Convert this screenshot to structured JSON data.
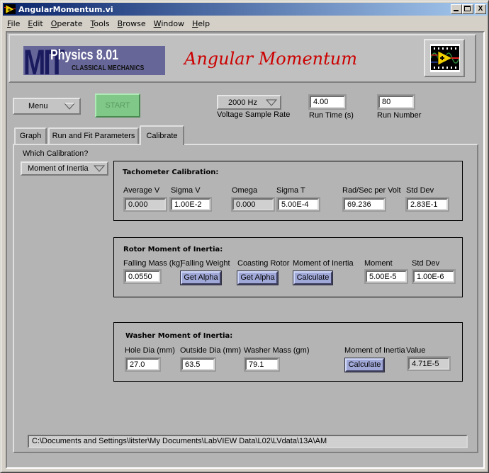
{
  "window": {
    "title": "AngularMomentum.vi",
    "buttons": {
      "minimize": "_",
      "maximize": "□",
      "close": "X"
    }
  },
  "menubar": {
    "items": [
      {
        "label": "File",
        "accel": "F"
      },
      {
        "label": "Edit",
        "accel": "E"
      },
      {
        "label": "Operate",
        "accel": "O"
      },
      {
        "label": "Tools",
        "accel": "T"
      },
      {
        "label": "Browse",
        "accel": "B"
      },
      {
        "label": "Window",
        "accel": "W"
      },
      {
        "label": "Help",
        "accel": "H"
      }
    ]
  },
  "header": {
    "logo": {
      "mit": "MIT",
      "course": "Physics 8.01",
      "subtitle": "CLASSICAL MECHANICS"
    },
    "title": "Angular Momentum",
    "vi_icon": "labview-vi-icon",
    "colors": {
      "title": "#cc0000",
      "logo_bg": "#666699",
      "start_button": "#80c888"
    }
  },
  "controls": {
    "menu_ring": "Menu",
    "start_button": "START",
    "sample_rate": {
      "value": "2000 Hz",
      "label": "Voltage Sample Rate"
    },
    "run_time": {
      "value": "4.00",
      "label": "Run Time (s)"
    },
    "run_number": {
      "value": "80",
      "label": "Run Number"
    }
  },
  "tabs": [
    {
      "label": "Graph",
      "active": false
    },
    {
      "label": "Run and Fit Parameters",
      "active": false
    },
    {
      "label": "Calibrate",
      "active": true
    }
  ],
  "calibrate": {
    "which_label": "Which Calibration?",
    "which_value": "Moment of Inertia",
    "tachometer": {
      "title": "Tachometer Calibration:",
      "average_v": {
        "label": "Average V",
        "value": "0.000"
      },
      "sigma_v": {
        "label": "Sigma V",
        "value": "1.00E-2"
      },
      "omega": {
        "label": "Omega",
        "value": "0.000"
      },
      "sigma_t": {
        "label": "Sigma T",
        "value": "5.00E-4"
      },
      "rad_per_volt": {
        "label": "Rad/Sec per Volt",
        "value": "69.236"
      },
      "std_dev": {
        "label": "Std Dev",
        "value": "2.83E-1"
      }
    },
    "rotor": {
      "title": "Rotor Moment of Inertia:",
      "falling_mass": {
        "label": "Falling Mass (kg)",
        "value": "0.0550"
      },
      "falling_weight": {
        "label": "Falling Weight",
        "button": "Get Alpha"
      },
      "coasting_rotor": {
        "label": "Coasting Rotor",
        "button": "Get Alpha"
      },
      "moment_of_inertia": {
        "label": "Moment of Inertia",
        "button": "Calculate"
      },
      "moment": {
        "label": "Moment",
        "value": "5.00E-5"
      },
      "std_dev": {
        "label": "Std Dev",
        "value": "1.00E-6"
      }
    },
    "washer": {
      "title": "Washer Moment of Inertia:",
      "hole_dia": {
        "label": "Hole Dia (mm)",
        "value": "27.0"
      },
      "outside_dia": {
        "label": "Outside Dia (mm)",
        "value": "63.5"
      },
      "washer_mass": {
        "label": "Washer Mass (gm)",
        "value": "79.1"
      },
      "moment_of_inertia": {
        "label": "Moment of Inertia",
        "button": "Calculate"
      },
      "value": {
        "label": "Value",
        "value": "4.71E-5"
      }
    }
  },
  "path": "C:\\Documents and Settings\\litster\\My Documents\\LabVIEW Data\\L02\\LVdata\\13A\\AM"
}
